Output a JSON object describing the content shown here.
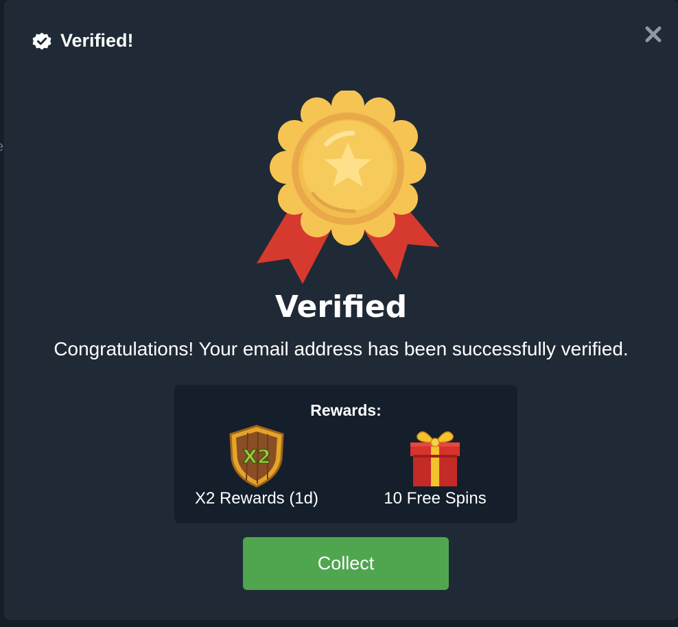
{
  "header": {
    "title": "Verified!",
    "icon": "verified-badge-icon"
  },
  "close": {
    "icon": "close-icon"
  },
  "hero": {
    "icon": "gold-medal-icon",
    "title": "Verified",
    "message": "Congratulations! Your email address has been successfully verified."
  },
  "rewards": {
    "title": "Rewards:",
    "items": [
      {
        "icon": "x2-shield-icon",
        "badge_text": "X2",
        "label": "X2 Rewards (1d)"
      },
      {
        "icon": "gift-box-icon",
        "label": "10 Free Spins"
      }
    ]
  },
  "collect": {
    "label": "Collect"
  },
  "colors": {
    "modal_bg": "#202a36",
    "rewards_bg": "#151f2b",
    "button_green": "#4fa64f",
    "medal_gold": "#f6c453",
    "ribbon_red": "#d63a2e"
  }
}
